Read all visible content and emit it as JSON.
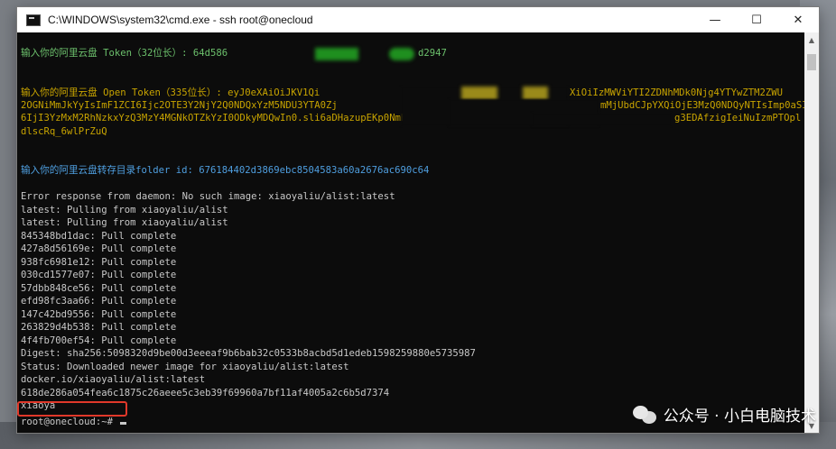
{
  "window": {
    "title": "C:\\WINDOWS\\system32\\cmd.exe - ssh  root@onecloud",
    "minimize_glyph": "—",
    "maximize_glyph": "☐",
    "close_glyph": "✕"
  },
  "terminal": {
    "token_prompt": "输入你的阿里云盘 Token（32位长）: 64d586",
    "token_tail": "d2947",
    "open_token_prompt": "输入你的阿里云盘 Open Token（335位长）: eyJ0eXAiOiJKV1Qi",
    "open_token_l1_tail": "XiOiIzMWViYTI2ZDNhMDk0Njg4YTYwZTM2ZWU",
    "open_token_l2_head": "2OGNiMmJkYyIsImF1ZCI6Ijc2OTE3Y2NjY2Q0NDQxYzM5NDU3YTA0Zj",
    "open_token_l2_tail": "mMjUbdCJpYXQiOjE3MzQ0NDQyNTIsImp0aSI",
    "open_token_l3_head": "6IjI3YzMxM2RhNzkxYzQ3MzY4MGNkOTZkYzI0ODkyMDQwIn0.sli6aDHazupEKp0NmK",
    "open_token_l3_tail": "g3EDAfzigIeiNuIzmPTOpl",
    "open_token_l4": "dlscRq_6wlPrZuQ",
    "folder_prompt": "输入你的阿里云盘转存目录folder id: 676184402d3869ebc8504583a60a2676ac690c64",
    "output_lines": [
      "Error response from daemon: No such image: xiaoyaliu/alist:latest",
      "latest: Pulling from xiaoyaliu/alist",
      "latest: Pulling from xiaoyaliu/alist",
      "845348bd1dac: Pull complete",
      "427a8d56169e: Pull complete",
      "938fc6981e12: Pull complete",
      "030cd1577e07: Pull complete",
      "57dbb848ce56: Pull complete",
      "efd98fc3aa66: Pull complete",
      "147c42bd9556: Pull complete",
      "263829d4b538: Pull complete",
      "4f4fb700ef54: Pull complete",
      "Digest: sha256:5098320d9be00d3eeeaf9b6bab32c0533b8acbd5d1edeb1598259880e5735987",
      "Status: Downloaded newer image for xiaoyaliu/alist:latest",
      "docker.io/xiaoyaliu/alist:latest",
      "618de286a054fea6c1875c26aeee5c3eb39f69960a7bf11af4005a2c6b5d7374",
      "xiaoya"
    ],
    "prompt": "root@onecloud:~# "
  },
  "watermark": {
    "text": "公众号 · 小白电脑技术"
  },
  "colors": {
    "terminal_bg": "#0c0c0c",
    "prompt_green": "#6cc06c",
    "open_token_gold": "#c8a400",
    "folder_blue": "#4f9fe0",
    "highlight_red": "#e0382a"
  }
}
